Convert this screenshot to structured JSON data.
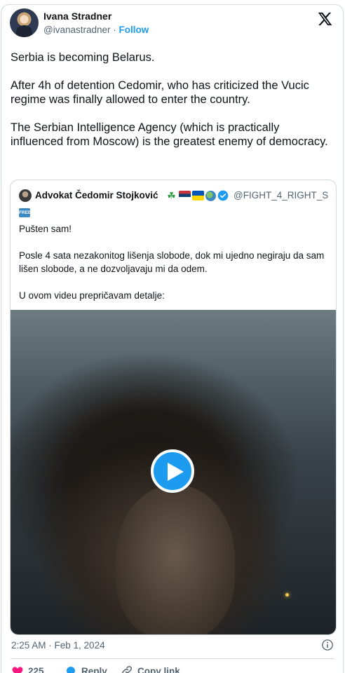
{
  "author": {
    "name": "Ivana Stradner",
    "handle": "@ivanastradner",
    "separator": "·",
    "follow_label": "Follow"
  },
  "tweet": {
    "text": "Serbia is becoming Belarus.\n\nAfter 4h of detention Cedomir, who has criticized the Vucic regime was finally allowed to enter the country.\n\nThe Serbian Intelligence Agency (which is practically influenced from Moscow) is the greatest enemy of democracy.",
    "timestamp": "2:25 AM · Feb 1, 2024"
  },
  "quote": {
    "name": "Advokat Čedomir Stojković",
    "emoji_icons": [
      "shamrock-icon",
      "serbia-flag-icon",
      "ukraine-flag-icon",
      "globe-icon"
    ],
    "handle": "@FIGHT_4_RIGHT_S",
    "badge": "FREE",
    "text": "Pušten sam!\n\nPosle 4 sata nezakonitog lišenja slobode, dok mi ujedno negiraju da sam lišen slobode, a ne dozvoljavaju mi da odem.\n\nU ovom videu prepričavam detalje:"
  },
  "actions": {
    "likes": "225",
    "reply_label": "Reply",
    "copy_link_label": "Copy link"
  },
  "colors": {
    "accent": "#1d9bf0",
    "like": "#f91880",
    "muted": "#536471",
    "border": "#cfd9de"
  }
}
